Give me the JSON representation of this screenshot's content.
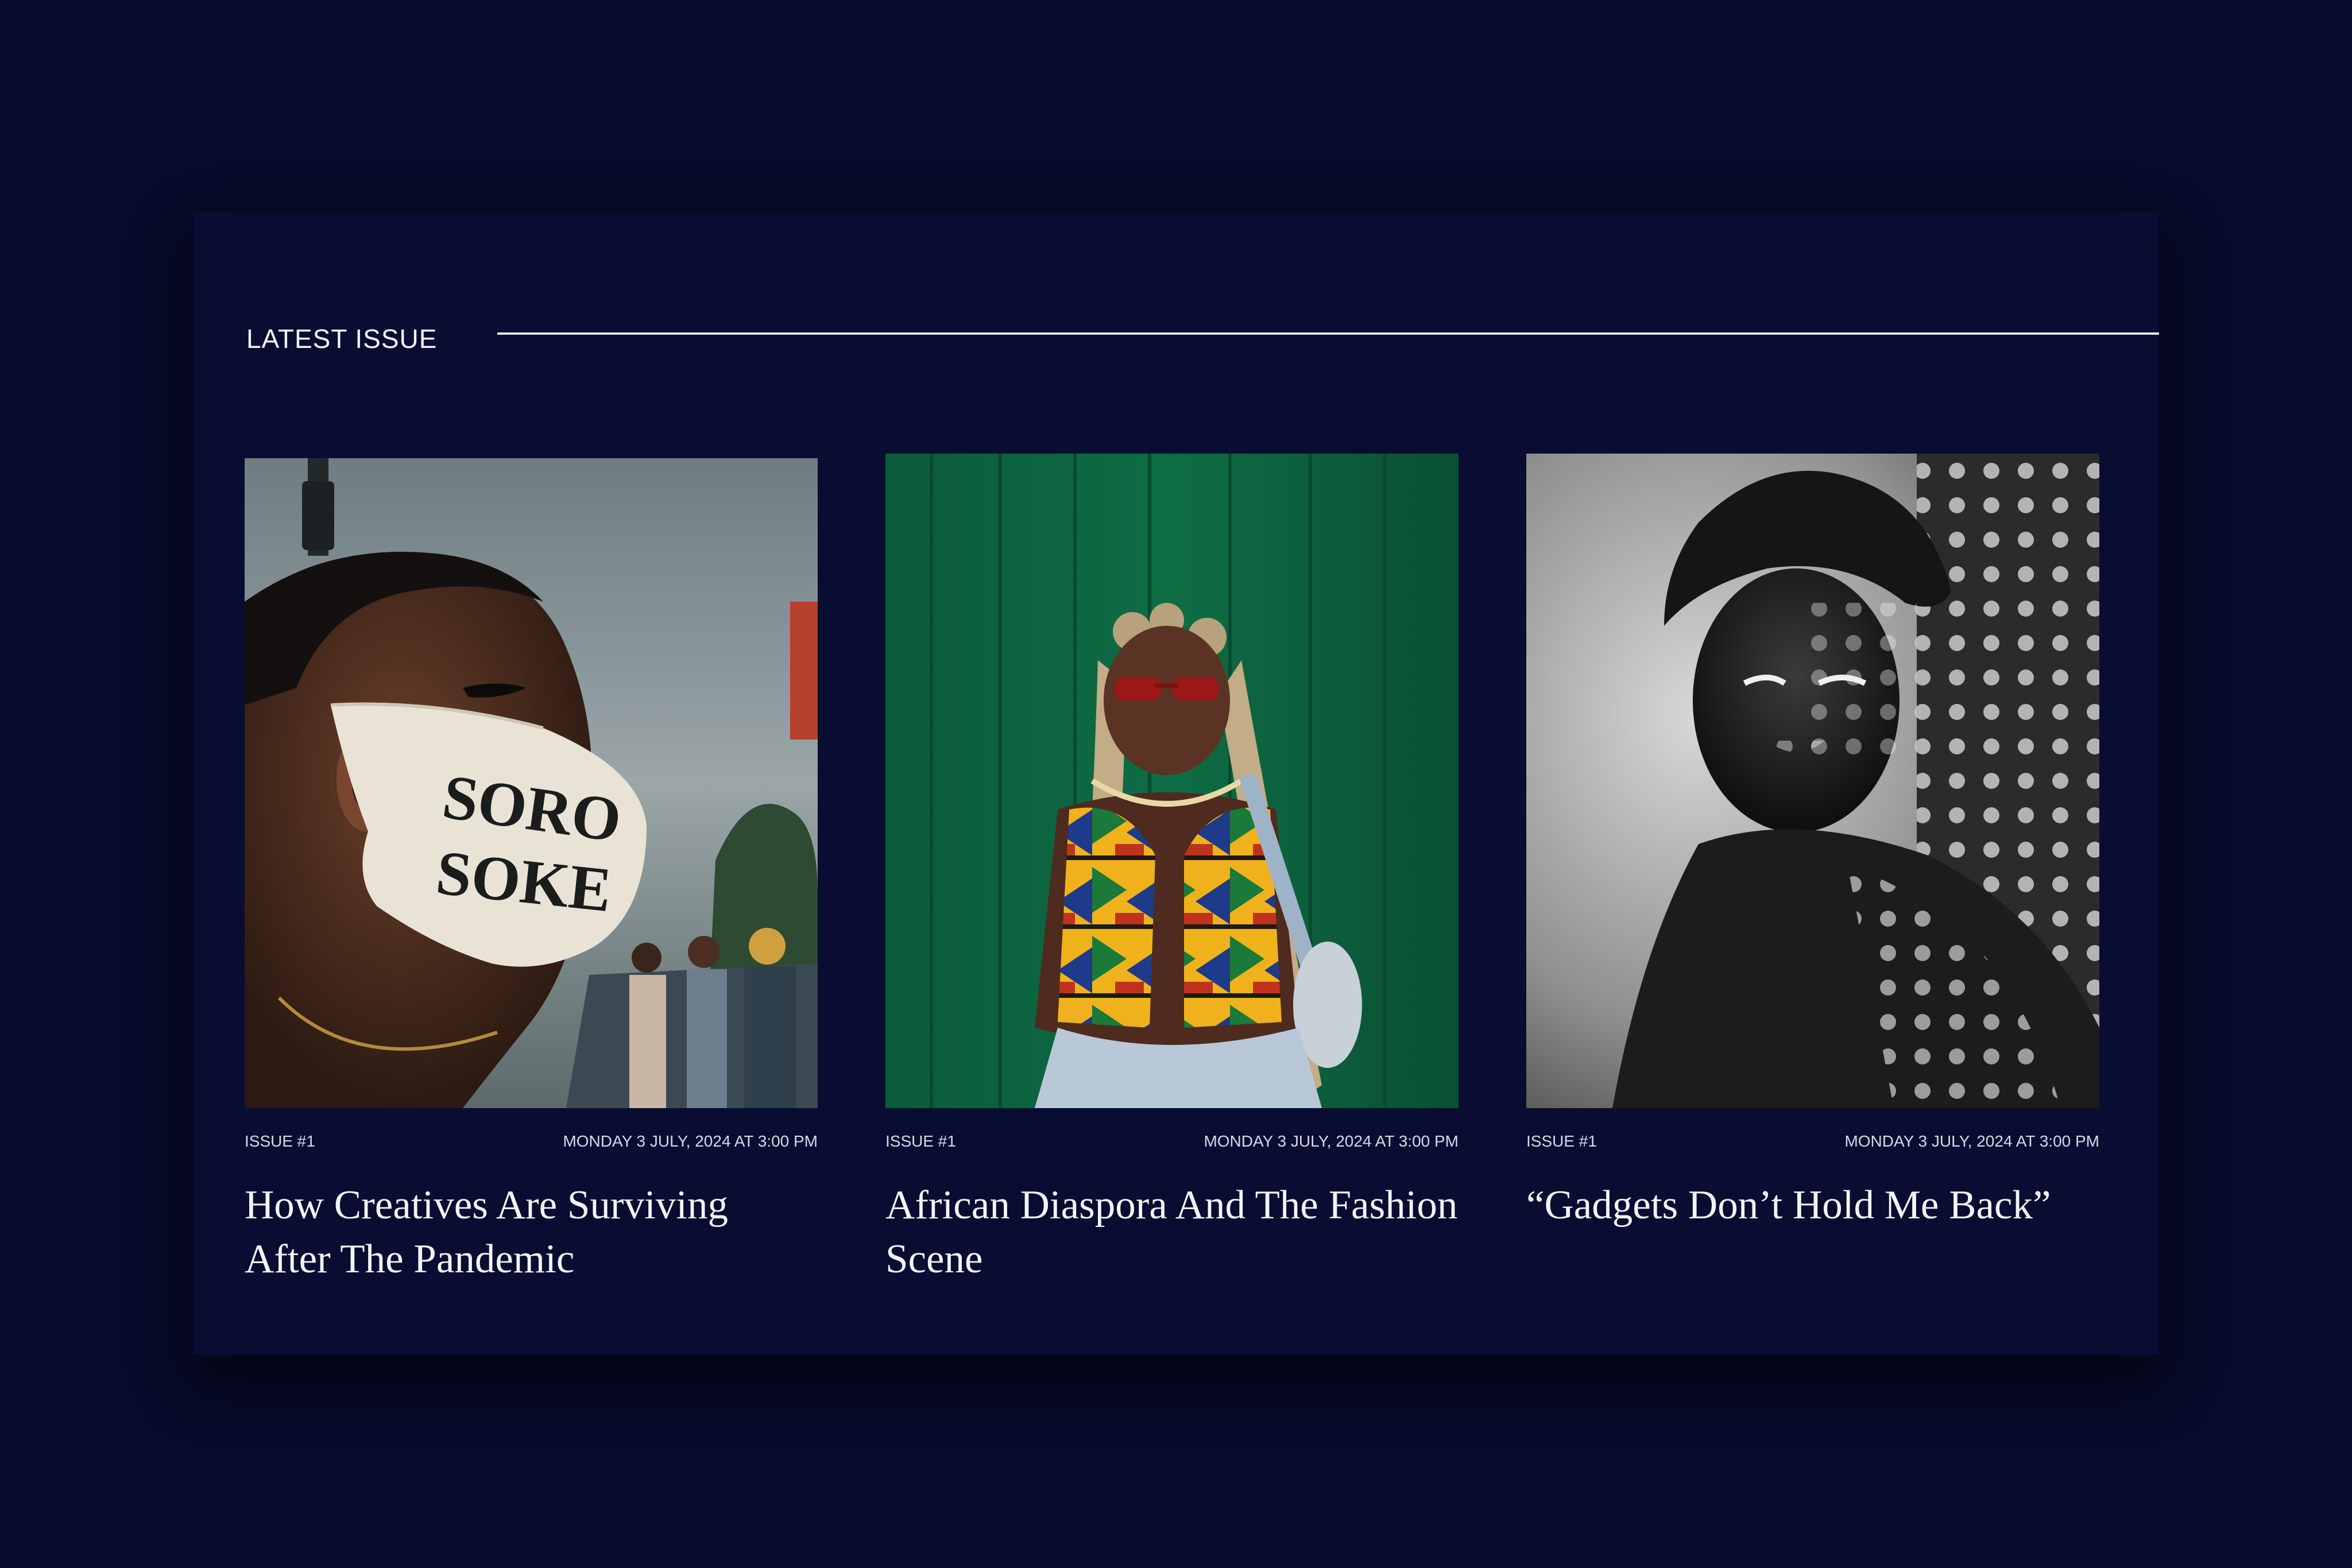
{
  "section": {
    "title": "LATEST ISSUE"
  },
  "articles": [
    {
      "issue": "ISSUE #1",
      "date": "MONDAY 3 JULY, 2024 AT 3:00 PM",
      "title": "How Creatives Are Surviving After The Pandemic",
      "image_text": "SORO SOKE"
    },
    {
      "issue": "ISSUE #1",
      "date": "MONDAY 3 JULY, 2024 AT 3:00 PM",
      "title": "African Diaspora And The Fashion Scene"
    },
    {
      "issue": "ISSUE #1",
      "date": "MONDAY 3 JULY, 2024 AT 3:00 PM",
      "title": "“Gadgets Don’t Hold Me Back”"
    }
  ],
  "colors": {
    "page_background": "#080c2e",
    "card_background": "#090d31",
    "text": "#f3f4f8"
  }
}
